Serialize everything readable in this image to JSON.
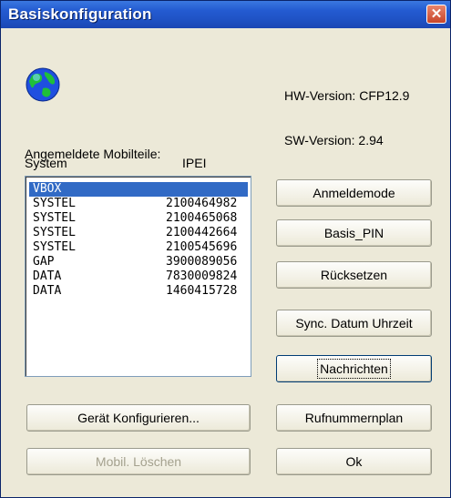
{
  "window": {
    "title": "Basiskonfiguration",
    "close_label": "✕"
  },
  "hw_version": "HW-Version: CFP12.9",
  "sw_version": "SW-Version: 2.94",
  "registered_label": "Angemeldete Mobilteile:",
  "list": {
    "columns": [
      "System",
      "IPEI"
    ],
    "rows": [
      {
        "system": "VBOX",
        "ipei": ""
      },
      {
        "system": "SYSTEL",
        "ipei": "2100464982"
      },
      {
        "system": "SYSTEL",
        "ipei": "2100465068"
      },
      {
        "system": "SYSTEL",
        "ipei": "2100442664"
      },
      {
        "system": "SYSTEL",
        "ipei": "2100545696"
      },
      {
        "system": "GAP",
        "ipei": "3900089056"
      },
      {
        "system": "DATA",
        "ipei": "7830009824"
      },
      {
        "system": "DATA",
        "ipei": "1460415728"
      }
    ],
    "selected_row": 0
  },
  "buttons": {
    "anmeldemode": "Anmeldemode",
    "basis_pin": "Basis_PIN",
    "ruecksetzen": "Rücksetzen",
    "sync": "Sync. Datum Uhrzeit",
    "nachrichten": "Nachrichten",
    "geraet": "Gerät Konfigurieren...",
    "rufnummernplan": "Rufnummernplan",
    "mobil_loeschen": "Mobil. Löschen",
    "ok": "Ok"
  },
  "colors": {
    "titlebar": "#245bd1",
    "selection": "#316ac5",
    "face": "#ece9d8"
  }
}
